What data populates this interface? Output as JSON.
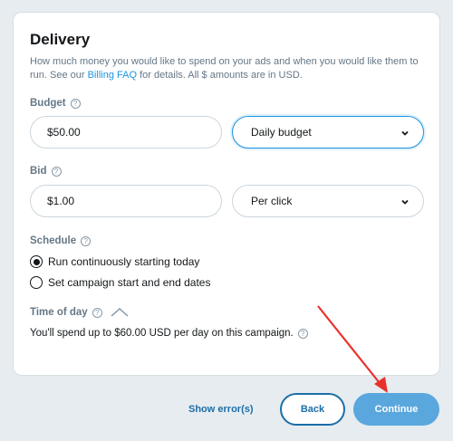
{
  "delivery": {
    "title": "Delivery",
    "desc_before": "How much money you would like to spend on your ads and when you would like them to run. See our ",
    "billing_link": "Billing FAQ",
    "desc_after": " for details. All $ amounts are in USD."
  },
  "budget": {
    "label": "Budget",
    "value": "$50.00",
    "type_selected": "Daily budget"
  },
  "bid": {
    "label": "Bid",
    "value": "$1.00",
    "type_selected": "Per click"
  },
  "schedule": {
    "label": "Schedule",
    "options": [
      {
        "label": "Run continuously starting today",
        "selected": true
      },
      {
        "label": "Set campaign start and end dates",
        "selected": false
      }
    ]
  },
  "time_of_day": {
    "label": "Time of day"
  },
  "summary": "You'll spend up to $60.00 USD per day on this campaign.",
  "footer": {
    "show_errors": "Show error(s)",
    "back": "Back",
    "continue": "Continue"
  },
  "colors": {
    "accent": "#1b95e0",
    "primary_button": "#5aa7dd",
    "annotation_arrow": "#e8322c"
  }
}
